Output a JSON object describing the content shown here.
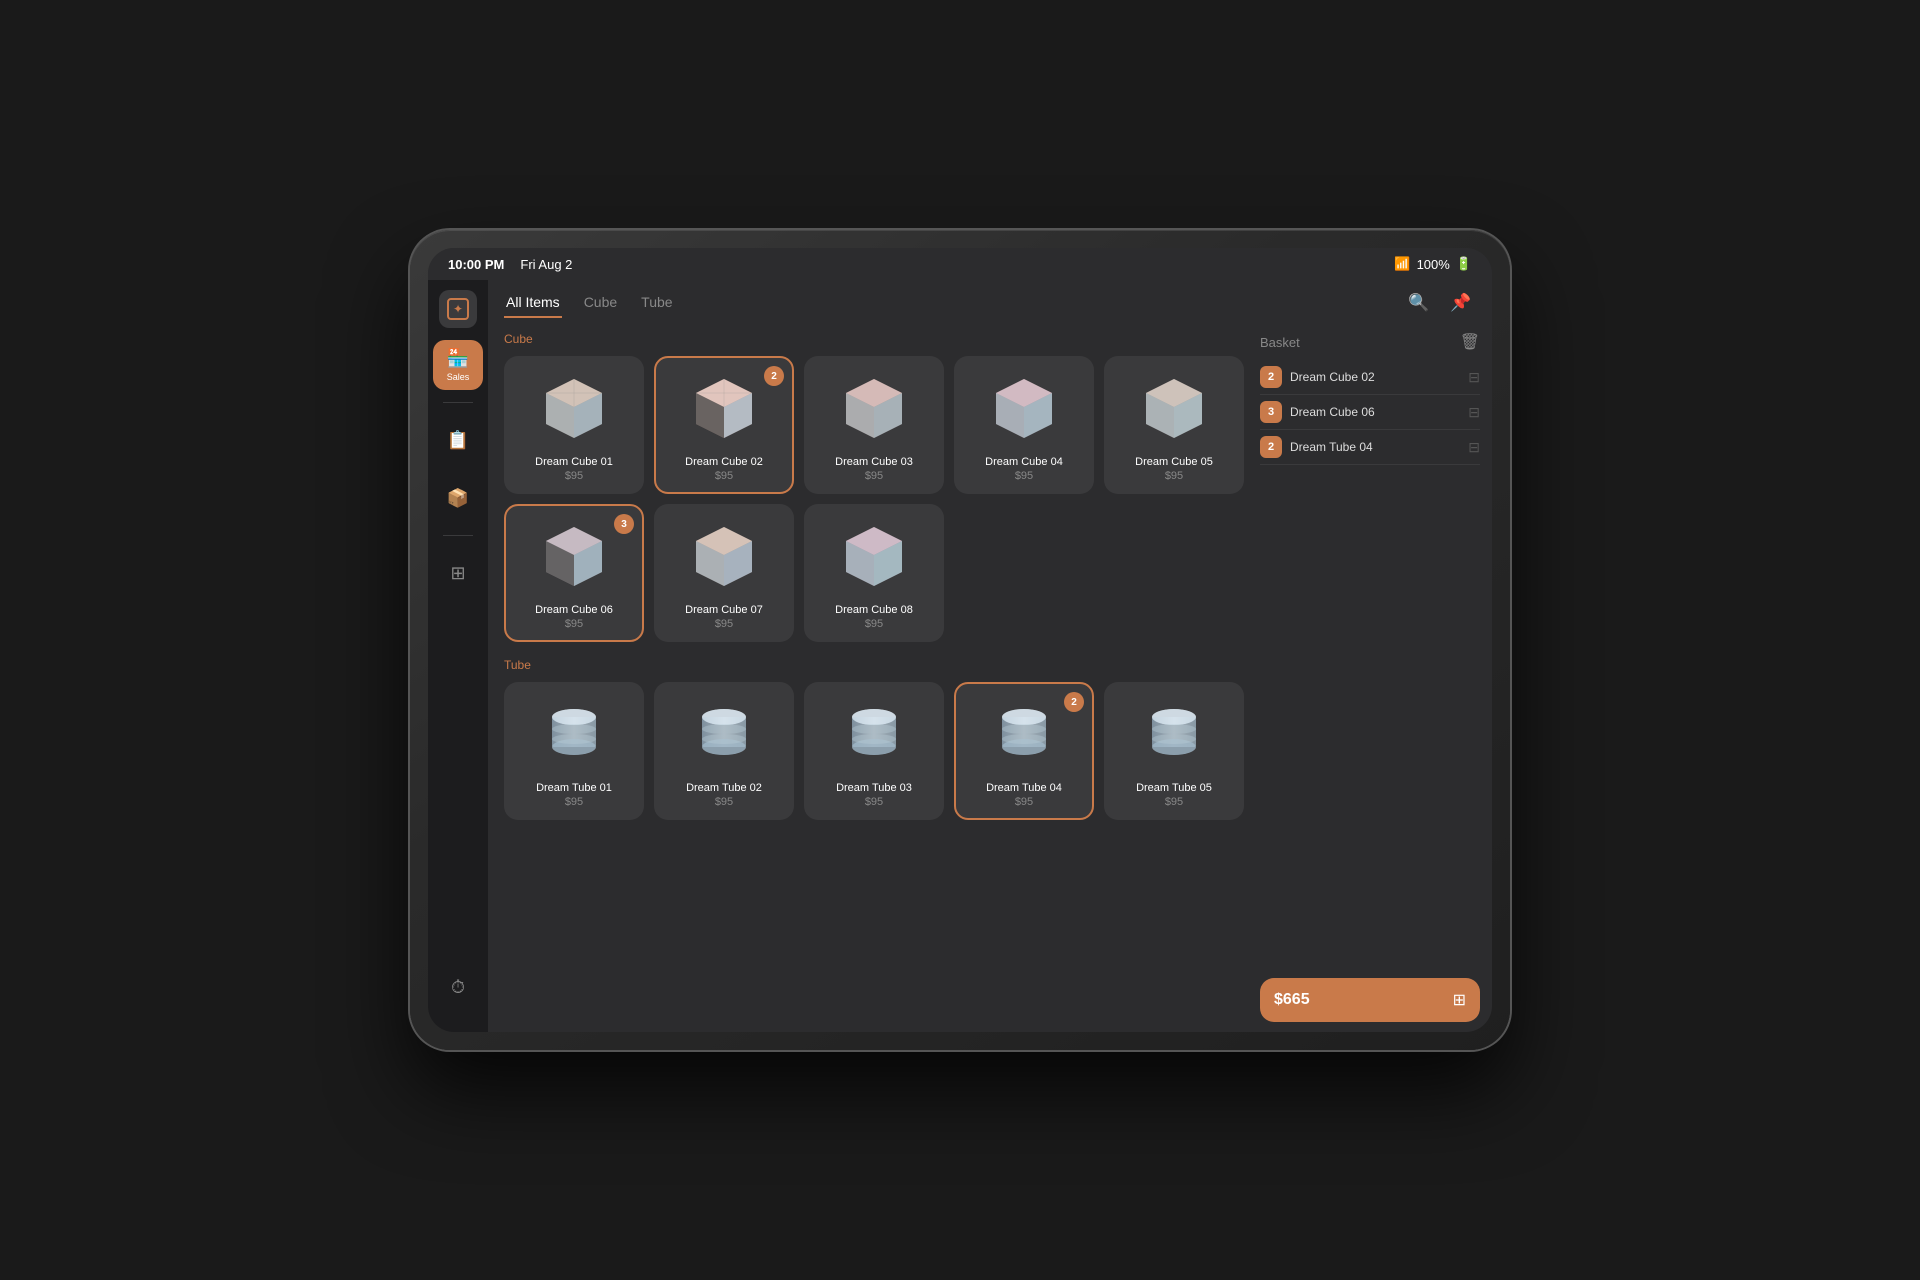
{
  "statusBar": {
    "time": "10:00 PM",
    "date": "Fri Aug 2",
    "battery": "100%",
    "wifiLabel": "WiFi"
  },
  "tabs": [
    {
      "id": "all",
      "label": "All Items",
      "active": true
    },
    {
      "id": "cube",
      "label": "Cube",
      "active": false
    },
    {
      "id": "tube",
      "label": "Tube",
      "active": false
    }
  ],
  "sidebar": {
    "items": [
      {
        "id": "logo",
        "icon": "✦",
        "label": "",
        "isLogo": true
      },
      {
        "id": "sales",
        "icon": "🏪",
        "label": "Sales",
        "active": true
      },
      {
        "id": "reports",
        "icon": "📋",
        "label": "",
        "active": false
      },
      {
        "id": "inventory",
        "icon": "📦",
        "label": "",
        "active": false
      },
      {
        "id": "settings",
        "icon": "⊞",
        "label": "",
        "active": false
      }
    ],
    "bottomItem": {
      "icon": "⏱",
      "label": ""
    }
  },
  "sections": [
    {
      "id": "cube",
      "label": "Cube",
      "products": [
        {
          "id": "cube01",
          "name": "Dream Cube 01",
          "price": "$95",
          "selected": false,
          "badge": null,
          "type": "cube",
          "color1": "#c4b0a0",
          "color2": "#a8bcc8"
        },
        {
          "id": "cube02",
          "name": "Dream Cube 02",
          "price": "$95",
          "selected": true,
          "badge": "2",
          "type": "cube",
          "color1": "#d4a898",
          "color2": "#b8c8d4"
        },
        {
          "id": "cube03",
          "name": "Dream Cube 03",
          "price": "$95",
          "selected": false,
          "badge": null,
          "type": "cube",
          "color1": "#c8a8a0",
          "color2": "#aabcc4"
        },
        {
          "id": "cube04",
          "name": "Dream Cube 04",
          "price": "$95",
          "selected": false,
          "badge": null,
          "type": "cube",
          "color1": "#c4a8b0",
          "color2": "#a8c0cc"
        },
        {
          "id": "cube05",
          "name": "Dream Cube 05",
          "price": "$95",
          "selected": false,
          "badge": null,
          "type": "cube",
          "color1": "#c0b0a8",
          "color2": "#b0c4cc"
        },
        {
          "id": "cube06",
          "name": "Dream Cube 06",
          "price": "$95",
          "selected": true,
          "badge": "3",
          "type": "cube",
          "color1": "#b8a8b0",
          "color2": "#a4bcc8"
        },
        {
          "id": "cube07",
          "name": "Dream Cube 07",
          "price": "$95",
          "selected": false,
          "badge": null,
          "type": "cube",
          "color1": "#c8b0a4",
          "color2": "#aabccc"
        },
        {
          "id": "cube08",
          "name": "Dream Cube 08",
          "price": "$95",
          "selected": false,
          "badge": null,
          "type": "cube",
          "color1": "#c0a8b8",
          "color2": "#a8c4cc"
        }
      ]
    },
    {
      "id": "tube",
      "label": "Tube",
      "products": [
        {
          "id": "tube01",
          "name": "Dream Tube 01",
          "price": "$95",
          "selected": false,
          "badge": null,
          "type": "tube"
        },
        {
          "id": "tube02",
          "name": "Dream Tube 02",
          "price": "$95",
          "selected": false,
          "badge": null,
          "type": "tube"
        },
        {
          "id": "tube03",
          "name": "Dream Tube 03",
          "price": "$95",
          "selected": false,
          "badge": null,
          "type": "tube"
        },
        {
          "id": "tube04",
          "name": "Dream Tube 04",
          "price": "$95",
          "selected": true,
          "badge": "2",
          "type": "tube"
        },
        {
          "id": "tube05",
          "name": "Dream Tube 05",
          "price": "$95",
          "selected": false,
          "badge": null,
          "type": "tube"
        }
      ]
    }
  ],
  "basket": {
    "title": "Basket",
    "items": [
      {
        "qty": "2",
        "name": "Dream Cube 02"
      },
      {
        "qty": "3",
        "name": "Dream Cube 06"
      },
      {
        "qty": "2",
        "name": "Dream Tube 04"
      }
    ],
    "total": "$665"
  }
}
